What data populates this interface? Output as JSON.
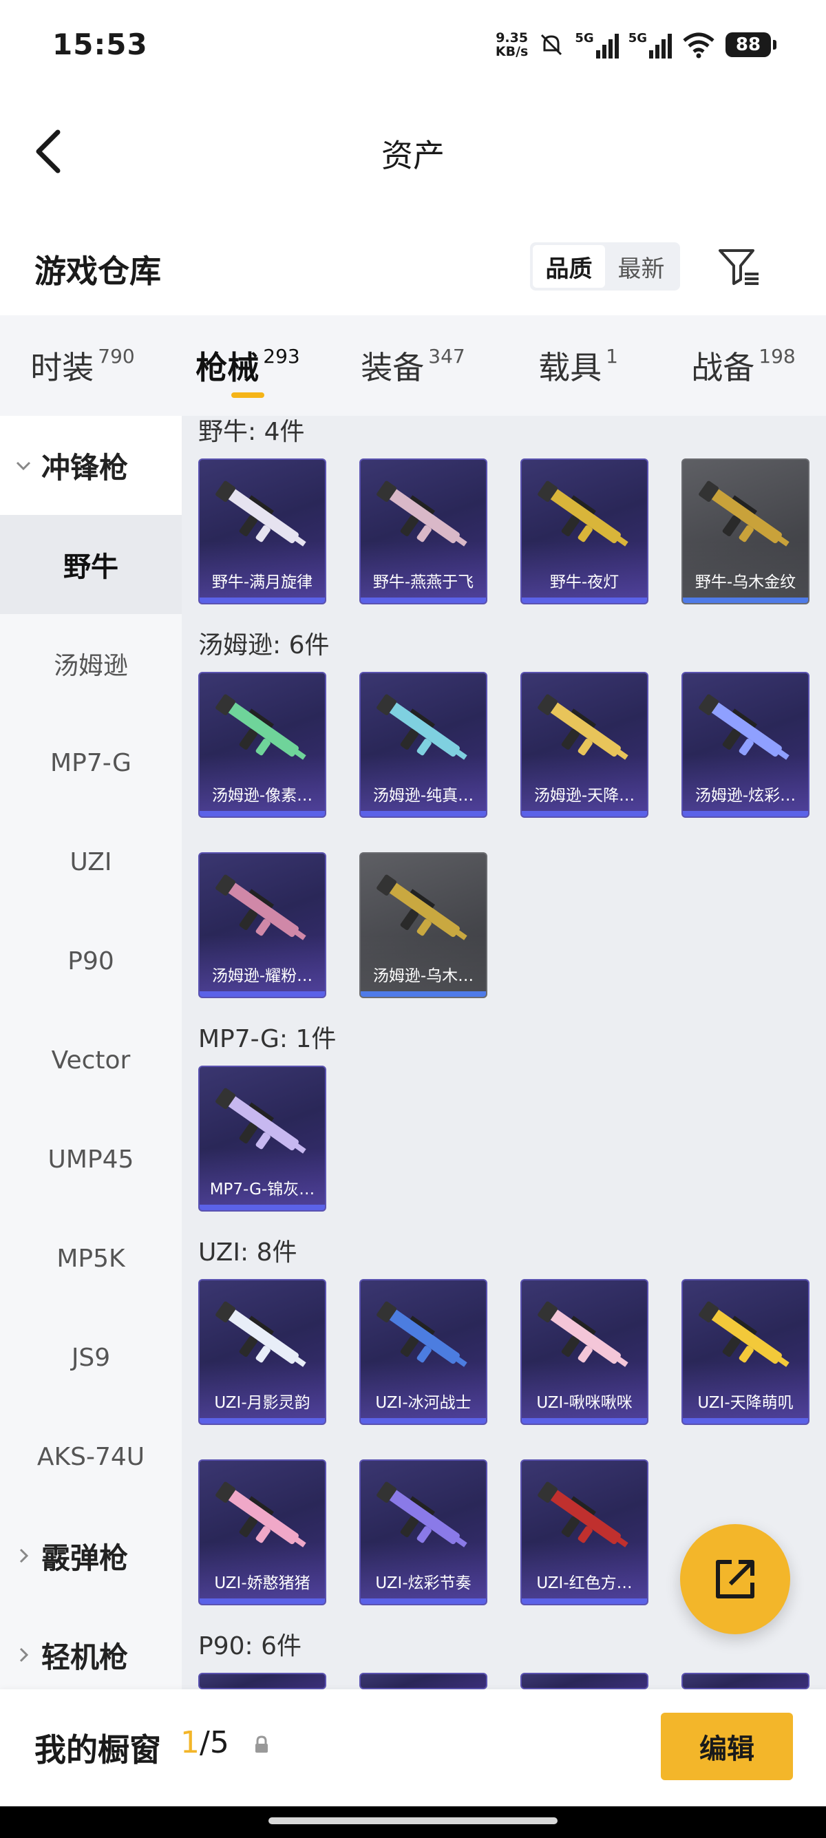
{
  "status_bar": {
    "time": "15:53",
    "net_speed_value": "9.35",
    "net_speed_unit": "KB/s",
    "signal1_label": "5G",
    "signal2_label": "5G",
    "battery": "88"
  },
  "header": {
    "title": "资产"
  },
  "warehouse": {
    "title": "游戏仓库",
    "sort_options": [
      "品质",
      "最新"
    ],
    "active_sort": "品质"
  },
  "tabs": [
    {
      "label": "时装",
      "count": "790"
    },
    {
      "label": "枪械",
      "count": "293",
      "active": true
    },
    {
      "label": "装备",
      "count": "347"
    },
    {
      "label": "载具",
      "count": "1"
    },
    {
      "label": "战备",
      "count": "198"
    }
  ],
  "sidebar": {
    "group_open": "冲锋枪",
    "items": [
      "野牛",
      "汤姆逊",
      "MP7-G",
      "UZI",
      "P90",
      "Vector",
      "UMP45",
      "MP5K",
      "JS9",
      "AKS-74U"
    ],
    "active_item": "野牛",
    "groups_closed": [
      "霰弹枪",
      "轻机枪"
    ]
  },
  "sections": [
    {
      "label": "野牛: 4件",
      "items": [
        "野牛-满月旋律",
        "野牛-燕燕于飞",
        "野牛-夜灯",
        "野牛-乌木金纹"
      ]
    },
    {
      "label": "汤姆逊: 6件",
      "items": [
        "汤姆逊-像素…",
        "汤姆逊-纯真…",
        "汤姆逊-天降…",
        "汤姆逊-炫彩…",
        "汤姆逊-耀粉…",
        "汤姆逊-乌木…"
      ]
    },
    {
      "label": "MP7-G: 1件",
      "items": [
        "MP7-G-锦灰…"
      ]
    },
    {
      "label": "UZI: 8件",
      "items": [
        "UZI-月影灵韵",
        "UZI-冰河战士",
        "UZI-啾咪啾咪",
        "UZI-天降萌叽",
        "UZI-娇憨猪猪",
        "UZI-炫彩节奏",
        "UZI-红色方…"
      ]
    },
    {
      "label": "P90: 6件",
      "items": []
    }
  ],
  "bottom": {
    "showcase_label": "我的橱窗",
    "showcase_current": "1",
    "showcase_total": "/5",
    "edit_label": "编辑"
  },
  "colors": {
    "accent": "#f3b62a",
    "card_purple": "#2a2758",
    "card_grey": "#45464b"
  }
}
